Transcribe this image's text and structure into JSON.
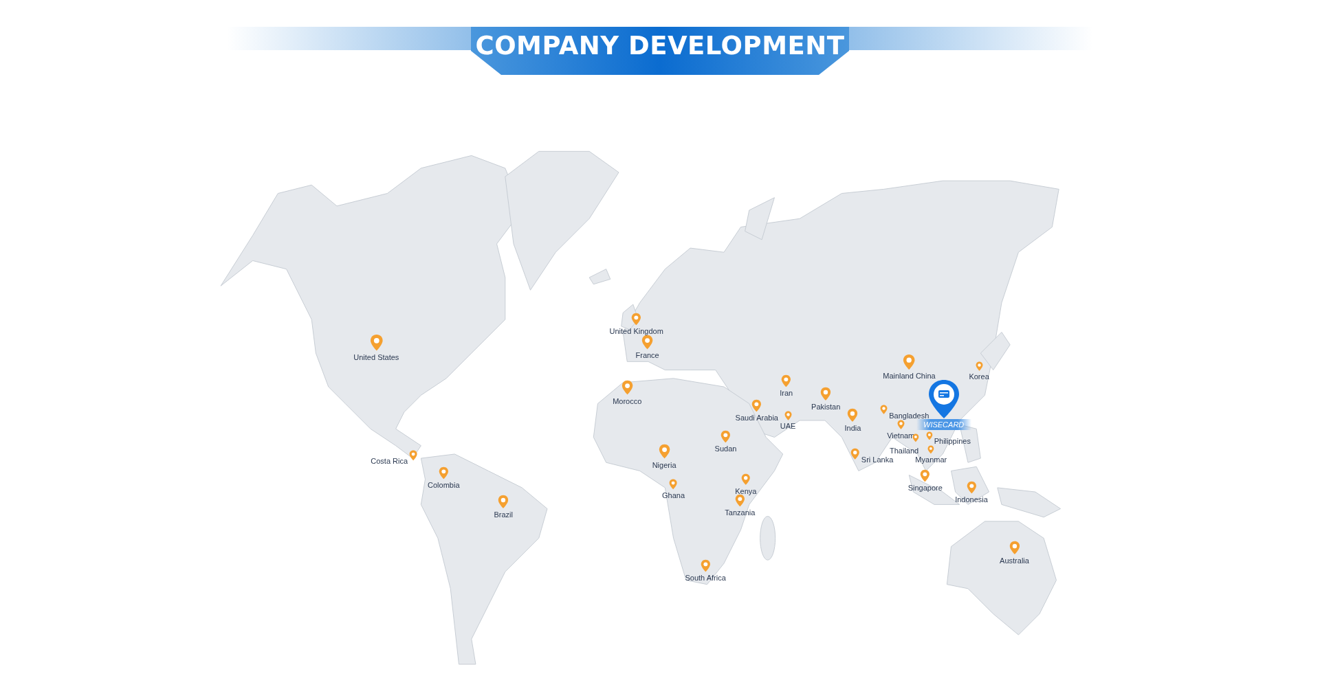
{
  "header": {
    "title": "COMPANY DEVELOPMENT"
  },
  "map": {
    "locations": [
      {
        "label": "United Kingdom"
      },
      {
        "label": "France"
      },
      {
        "label": "United States"
      },
      {
        "label": "Mainland China"
      },
      {
        "label": "Korea"
      },
      {
        "label": "Iran"
      },
      {
        "label": "Morocco"
      },
      {
        "label": "Pakistan"
      },
      {
        "label": "Saudi Arabia"
      },
      {
        "label": "Bangladesh"
      },
      {
        "label": "UAE"
      },
      {
        "label": "India"
      },
      {
        "label": "Vietnam"
      },
      {
        "label": "Philippines"
      },
      {
        "label": "Thailand"
      },
      {
        "label": "Sudan"
      },
      {
        "label": "Myanmar"
      },
      {
        "label": "Nigeria"
      },
      {
        "label": "Costa Rica"
      },
      {
        "label": "Sri Lanka"
      },
      {
        "label": "Colombia"
      },
      {
        "label": "Singapore"
      },
      {
        "label": "Kenya"
      },
      {
        "label": "Ghana"
      },
      {
        "label": "Indonesia"
      },
      {
        "label": "Tanzania"
      },
      {
        "label": "Brazil"
      },
      {
        "label": "Australia"
      },
      {
        "label": "South Africa"
      }
    ],
    "headquarters": {
      "label": "WISECARD"
    }
  }
}
